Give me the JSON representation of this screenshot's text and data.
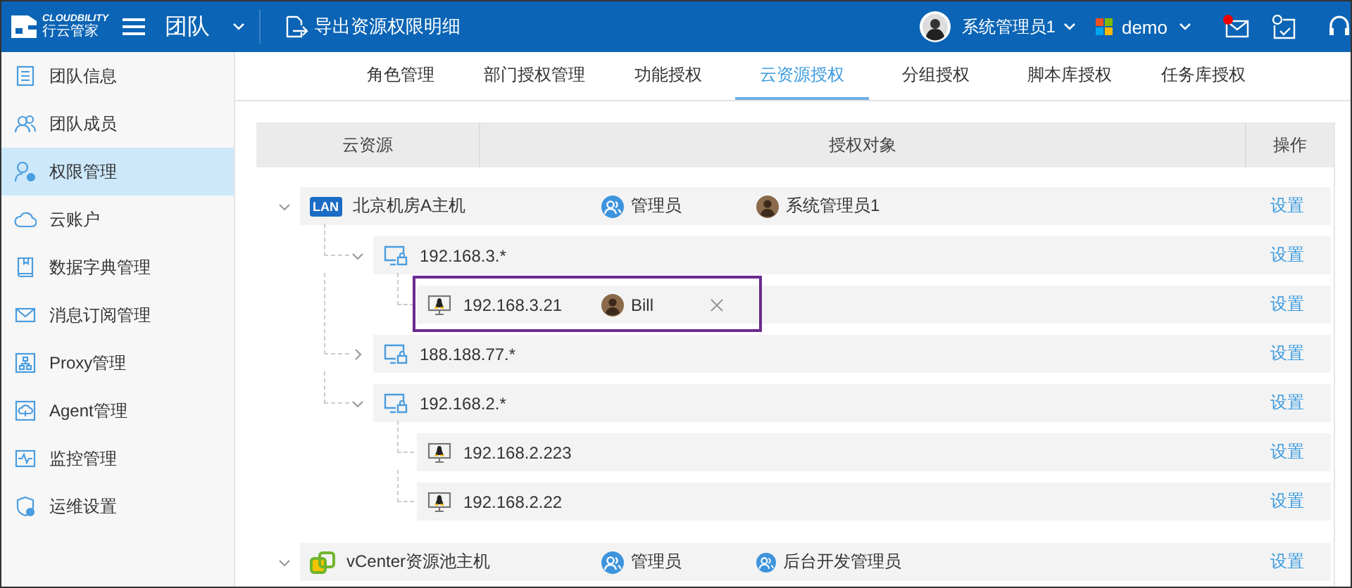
{
  "header": {
    "logo_text": "CLOUDBILITY",
    "logo_subtext": "行云管家",
    "module": "团队",
    "export_action": "导出资源权限明细",
    "user": "系统管理员1",
    "org": "demo",
    "unread_messages": true
  },
  "sidebar": {
    "items": [
      {
        "label": "团队信息",
        "selected": false
      },
      {
        "label": "团队成员",
        "selected": false
      },
      {
        "label": "权限管理",
        "selected": true
      },
      {
        "label": "云账户",
        "selected": false
      },
      {
        "label": "数据字典管理",
        "selected": false
      },
      {
        "label": "消息订阅管理",
        "selected": false
      },
      {
        "label": "Proxy管理",
        "selected": false
      },
      {
        "label": "Agent管理",
        "selected": false
      },
      {
        "label": "监控管理",
        "selected": false
      },
      {
        "label": "运维设置",
        "selected": false
      }
    ]
  },
  "tabs": [
    {
      "label": "角色管理",
      "selected": false
    },
    {
      "label": "部门授权管理",
      "selected": false
    },
    {
      "label": "功能授权",
      "selected": false
    },
    {
      "label": "云资源授权",
      "selected": true
    },
    {
      "label": "分组授权",
      "selected": false
    },
    {
      "label": "脚本库授权",
      "selected": false
    },
    {
      "label": "任务库授权",
      "selected": false
    }
  ],
  "table": {
    "columns": [
      "云资源",
      "授权对象",
      "操作"
    ],
    "rows": [
      {
        "kind": "lan",
        "badge": "LAN",
        "name": "北京机房A主机",
        "expanded": true,
        "highlighted": false,
        "grants": [
          {
            "kind": "role",
            "name": "管理员",
            "removable": false
          },
          {
            "kind": "user",
            "name": "系统管理员1",
            "removable": false
          }
        ],
        "action": "设置",
        "children": [
          {
            "kind": "subnet",
            "name": "192.168.3.*",
            "expanded": true,
            "highlighted": false,
            "action": "设置",
            "children": [
              {
                "kind": "host",
                "name": "192.168.3.21",
                "highlighted": true,
                "grants": [
                  {
                    "kind": "user",
                    "name": "Bill",
                    "removable": true
                  }
                ],
                "action": "设置"
              }
            ]
          },
          {
            "kind": "subnet",
            "name": "188.188.77.*",
            "expanded": false,
            "highlighted": false,
            "action": "设置"
          },
          {
            "kind": "subnet",
            "name": "192.168.2.*",
            "expanded": true,
            "highlighted": false,
            "action": "设置",
            "children": [
              {
                "kind": "host",
                "name": "192.168.2.223",
                "highlighted": false,
                "action": "设置"
              },
              {
                "kind": "host",
                "name": "192.168.2.22",
                "highlighted": false,
                "action": "设置"
              }
            ]
          }
        ]
      },
      {
        "kind": "vcenter",
        "name": "vCenter资源池主机",
        "expanded": true,
        "highlighted": false,
        "grants": [
          {
            "kind": "role",
            "name": "管理员",
            "removable": false
          },
          {
            "kind": "role",
            "name": "后台开发管理员",
            "removable": false
          }
        ],
        "action": "设置"
      }
    ]
  }
}
